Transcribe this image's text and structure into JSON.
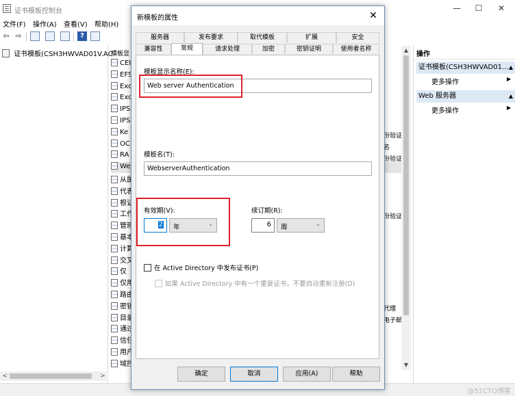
{
  "window": {
    "title": "证书模板控制台",
    "minimize": "—",
    "maximize": "☐",
    "close": "✕"
  },
  "menu": [
    "文件(F)",
    "操作(A)",
    "查看(V)",
    "帮助(H)"
  ],
  "tree": {
    "root_label": "证书模板(CSH3HWVAD01V.AC"
  },
  "list": {
    "header": "模板显",
    "items": [
      "CEI",
      "EFS",
      "Exc",
      "Exc",
      "IPS",
      "IPS",
      "Ke",
      "OC",
      "RA",
      "We",
      "从属",
      "代表",
      "根证",
      "工作",
      "管理",
      "基本",
      "计算",
      "交叉",
      "仅",
      "仅用",
      "路由",
      "密钥",
      "目录",
      "通过",
      "信任",
      "用户",
      "域控"
    ],
    "right_texts": [
      "份验证",
      "名",
      "份验证",
      "份验证",
      "代理",
      "电子邮"
    ]
  },
  "actions": {
    "title": "操作",
    "group1": "证书模板(CSH3HWVAD01...",
    "group1_more": "更多操作",
    "group2": "Web 服务器",
    "group2_more": "更多操作"
  },
  "watermark": "@51CTO博客",
  "dialog": {
    "title": "新模板的属性",
    "close": "✕",
    "tabs_row1": [
      "服务器",
      "发布要求",
      "取代模板",
      "扩展",
      "安全"
    ],
    "tabs_row2": [
      "兼容性",
      "常规",
      "请求处理",
      "加密",
      "密钥证明",
      "使用者名称"
    ],
    "active_tab": "常规",
    "display_name_label": "模板显示名称(E):",
    "display_name_value": "Web server Authentication",
    "template_name_label": "模板名(T):",
    "template_name_value": "WebserverAuthentication",
    "validity_label": "有效期(V):",
    "validity_value": "2",
    "validity_unit": "年",
    "renewal_label": "续订期(R):",
    "renewal_value": "6",
    "renewal_unit": "周",
    "publish_ad_label": "在 Active Directory 中发布证书(P)",
    "no_reenroll_label": "如果 Active Directory 中有一个重复证书，不要自动重新注册(D)",
    "buttons": {
      "ok": "确定",
      "cancel": "取消",
      "apply": "应用(A)",
      "help": "帮助"
    }
  },
  "colors": {
    "highlight_red": "#e0202a",
    "accent_blue": "#0078d7"
  }
}
